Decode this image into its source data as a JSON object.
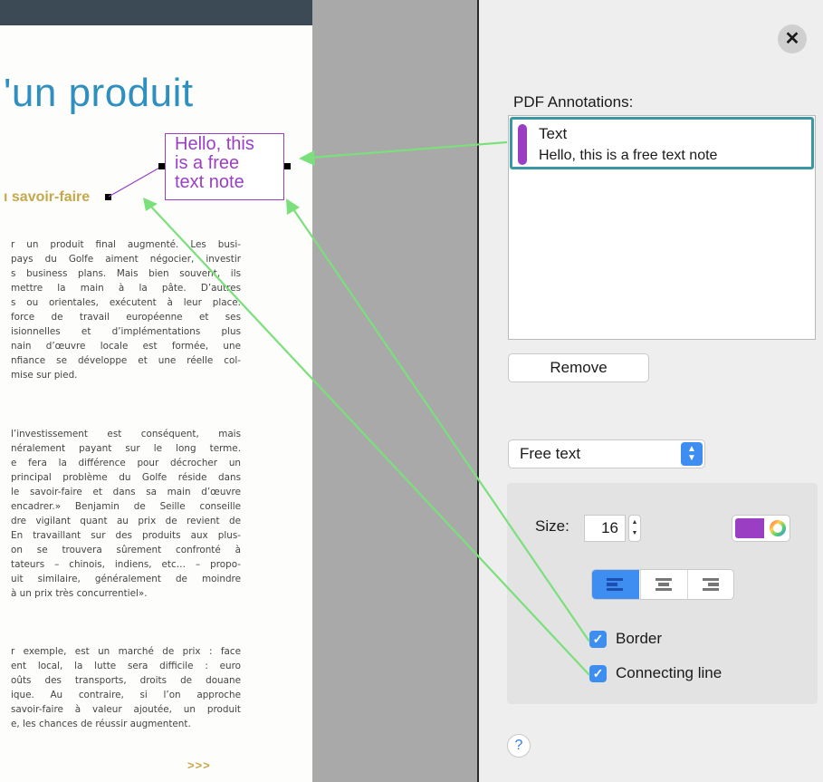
{
  "document": {
    "title": "'un produit",
    "subheading": "ı savoir-faire",
    "note_text_lines": [
      "Hello, this",
      "is a free",
      "text note"
    ],
    "paragraph1": [
      "r un produit final augmenté. Les busi-",
      "pays du Golfe aiment négocier, investir",
      "s business plans. Mais bien souvent, ils",
      "mettre la main à la pâte. D’autres",
      "s ou orientales, exécutent à leur place.",
      "force de travail européenne et ses",
      "isionnelles et d’implémentations plus",
      "nain d’œuvre locale est formée, une",
      "nfiance se développe et une réelle col-",
      "mise sur pied."
    ],
    "paragraph2": [
      "l’investissement est conséquent, mais",
      "néralement payant sur le long terme.",
      "e fera la différence pour décrocher un",
      "principal problème du Golfe réside dans",
      "le savoir-faire et dans sa main d’œuvre",
      "encadrer.» Benjamin de Seille conseille",
      "dre vigilant quant au prix de revient de",
      "En travaillant sur des produits aux plus-",
      "on se trouvera sûrement confronté à",
      "tateurs – chinois, indiens, etc… – propo-",
      "uit similaire, généralement de moindre",
      "à un prix très concurrentiel»."
    ],
    "paragraph3": [
      "r exemple, est un marché de prix : face",
      "ent local, la lutte sera difficile : euro",
      "oûts des transports, droits de douane",
      "ique. Au contraire, si l’on approche",
      "savoir-faire à valeur ajoutée, un produit",
      "e, les chances de réussir augmentent."
    ],
    "more": ">>>"
  },
  "panel": {
    "close_glyph": "✕",
    "label": "PDF Annotations:",
    "annotations": [
      {
        "type": "Text",
        "content": "Hello, this is a free text note",
        "color": "#9a3fc4"
      }
    ],
    "remove_label": "Remove",
    "annotation_kind": "Free text",
    "size_label": "Size:",
    "size_value": "16",
    "font_color": "#9a3fc4",
    "alignment_selected": "left",
    "border_label": "Border",
    "border_checked": true,
    "connecting_line_label": "Connecting line",
    "connecting_line_checked": true,
    "help_glyph": "?"
  },
  "colors": {
    "accent": "#3d8ef0",
    "selection_border": "#3a98a4",
    "annotation_purple": "#9a3fc4",
    "callout_green": "#7be07b",
    "doc_title_blue": "#2f8fbf",
    "doc_gold": "#c6a84a"
  },
  "icons": [
    "close-icon",
    "chevron-updown-icon",
    "stepper-icon",
    "color-wheel-icon",
    "align-left-icon",
    "align-center-icon",
    "align-right-icon",
    "checkmark-icon",
    "help-icon"
  ]
}
